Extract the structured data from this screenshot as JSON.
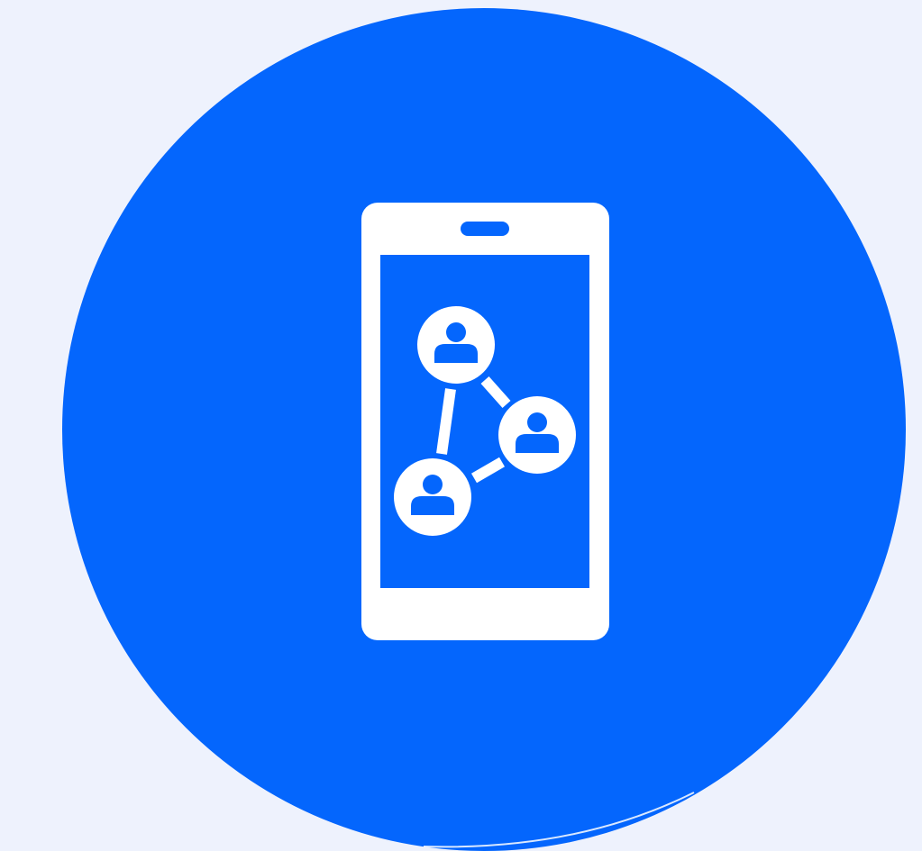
{
  "colors": {
    "background": "#eef2fd",
    "circle": "#0466fd",
    "icon": "#ffffff"
  },
  "icon": {
    "name": "mobile-social-network-icon",
    "device": "smartphone",
    "nodes": [
      "user-icon",
      "user-icon",
      "user-icon"
    ]
  }
}
